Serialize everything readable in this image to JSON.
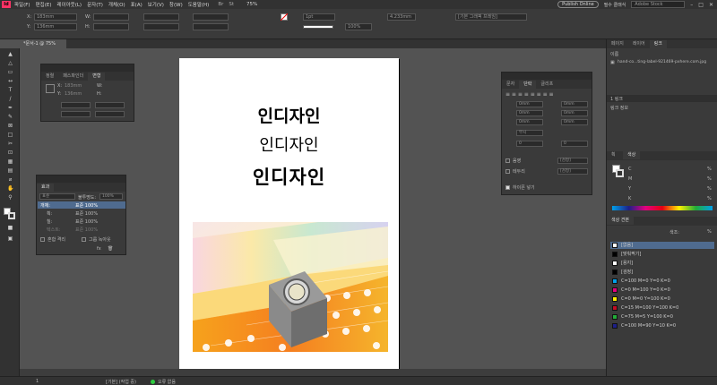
{
  "menubar": {
    "logo": "Id",
    "items": [
      "파일(F)",
      "편집(E)",
      "레이아웃(L)",
      "문자(T)",
      "개체(O)",
      "표(A)",
      "보기(V)",
      "창(W)",
      "도움말(H)"
    ],
    "zoom": "75%",
    "publish": "Publish Online",
    "essentials": "필수 클래식",
    "stock_placeholder": "Adobe Stock"
  },
  "control": {
    "x": "183mm",
    "y": "136mm",
    "x_label": "X:",
    "y_label": "Y:",
    "w_label": "W:",
    "h_label": "H:",
    "stroke_weight": "1pt",
    "opacity": "100%",
    "size": "4.233mm",
    "frame_style": "[기본 그래픽 프레임]"
  },
  "document_tab": "*문서-1 @ 75%",
  "page": {
    "line1": "인디자인",
    "line2": "인디자인",
    "line3": "인디자인"
  },
  "transform_panel": {
    "tabs": [
      "정렬",
      "패스파인더",
      "변형"
    ],
    "active": "변형",
    "x_label": "X:",
    "x": "183mm",
    "y_label": "Y:",
    "y": "136mm",
    "w_label": "W:",
    "h_label": "H:"
  },
  "effects_panel": {
    "title": "효과",
    "mode": "표준",
    "opacity_label": "불투명도:",
    "opacity": "100%",
    "rows": [
      {
        "name": "개체:",
        "value": "표준 100%"
      },
      {
        "name": "획:",
        "value": "표준 100%"
      },
      {
        "name": "칠:",
        "value": "표준 100%"
      },
      {
        "name": "텍스트:",
        "value": "표준 100%"
      }
    ],
    "isolate": "혼합 격리",
    "knockout": "그룹 녹아웃"
  },
  "paragraph_panel": {
    "tabs": [
      "문자",
      "단락",
      "글리프"
    ],
    "active": "단락",
    "fields": [
      "0mm",
      "0mm",
      "0mm",
      "0mm",
      "0mm",
      "0mm",
      "0",
      "0"
    ],
    "hyphen_option": "무시",
    "shading": "음영",
    "border": "테두리",
    "hyphenate": "하이픈 넣기",
    "color": "[검정]"
  },
  "links_panel": {
    "tabs": [
      "페이지",
      "레이어",
      "링크"
    ],
    "active": "링크",
    "header": "이름",
    "file": "hand-co...ting-label-921469-pxhere.com.jpg",
    "selected": "1 링크",
    "info": "링크 정보"
  },
  "color_panel": {
    "tabs": [
      "획",
      "색상"
    ],
    "channels": [
      {
        "label": "C",
        "value": "%"
      },
      {
        "label": "M",
        "value": "%"
      },
      {
        "label": "Y",
        "value": "%"
      },
      {
        "label": "K",
        "value": "%"
      }
    ]
  },
  "swatches_panel": {
    "title": "색상 견본",
    "tint_label": "색조:",
    "tint_unit": "%",
    "items": [
      {
        "name": "[없음]",
        "color": "#ffffff"
      },
      {
        "name": "[맞춰찍기]",
        "color": "#000000"
      },
      {
        "name": "[용지]",
        "color": "#ffffff"
      },
      {
        "name": "[검정]",
        "color": "#000000"
      },
      {
        "name": "C=100 M=0 Y=0 K=0",
        "color": "#00a0e9"
      },
      {
        "name": "C=0 M=100 Y=0 K=0",
        "color": "#e4007f"
      },
      {
        "name": "C=0 M=0 Y=100 K=0",
        "color": "#fff100"
      },
      {
        "name": "C=15 M=100 Y=100 K=0",
        "color": "#c30d23"
      },
      {
        "name": "C=75 M=5 Y=100 K=0",
        "color": "#22ac38"
      },
      {
        "name": "C=100 M=90 Y=10 K=0",
        "color": "#1d2088"
      }
    ]
  },
  "status": {
    "page": "1",
    "style": "[기본] (작업 중)",
    "errors": "오류 없음"
  }
}
